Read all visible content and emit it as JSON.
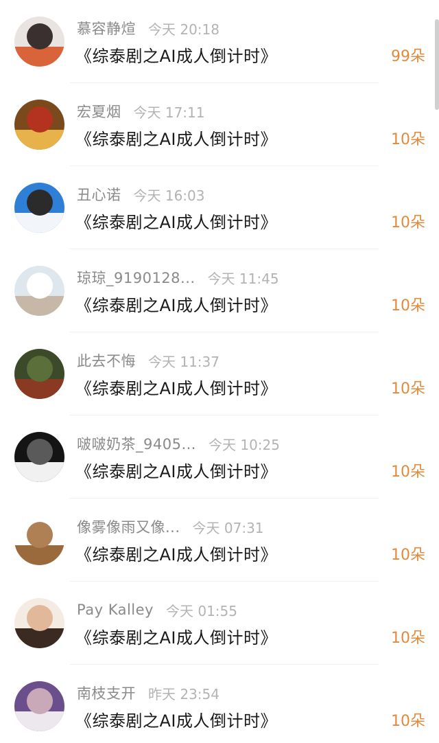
{
  "items": [
    {
      "name": "慕容静煊",
      "time": "今天 20:18",
      "title": "《综泰剧之AI成人倒计时》",
      "count": "99朵",
      "avatar_icon": "woman-in-red-hanfu-avatar",
      "avatar_colors": [
        "#e9e4e2",
        "#d9643a",
        "#3b3030"
      ]
    },
    {
      "name": "宏夏烟",
      "time": "今天 17:11",
      "title": "《综泰剧之AI成人倒计时》",
      "count": "10朵",
      "avatar_icon": "golden-warrior-avatar",
      "avatar_colors": [
        "#7a4a1c",
        "#e8b24a",
        "#b3331f"
      ]
    },
    {
      "name": "丑心诺",
      "time": "今天 16:03",
      "title": "《综泰剧之AI成人倒计时》",
      "count": "10朵",
      "avatar_icon": "girl-blue-sky-avatar",
      "avatar_colors": [
        "#2f7fd6",
        "#f2f6fa",
        "#2b2b2b"
      ]
    },
    {
      "name": "琼琼_9190128...",
      "time": "今天 11:45",
      "title": "《综泰剧之AI成人倒计时》",
      "count": "10朵",
      "avatar_icon": "beach-scene-avatar",
      "avatar_colors": [
        "#dfe7ee",
        "#c7b7a7",
        "#ffffff"
      ]
    },
    {
      "name": "此去不悔",
      "time": "今天 11:37",
      "title": "《综泰剧之AI成人倒计时》",
      "count": "10朵",
      "avatar_icon": "forest-avatar",
      "avatar_colors": [
        "#3c4a2a",
        "#8a3a22",
        "#5a6f3a"
      ]
    },
    {
      "name": "啵啵奶茶_9405...",
      "time": "今天 10:25",
      "title": "《综泰剧之AI成人倒计时》",
      "count": "10朵",
      "avatar_icon": "cat-avatar",
      "avatar_colors": [
        "#141414",
        "#f1f1f1",
        "#5a5a5a"
      ]
    },
    {
      "name": "像雾像雨又像...",
      "time": "今天 07:31",
      "title": "《综泰剧之AI成人倒计时》",
      "count": "10朵",
      "avatar_icon": "calligraphy-logo-avatar",
      "avatar_colors": [
        "#ffffff",
        "#9b6a3c",
        "#b08055"
      ]
    },
    {
      "name": "Pay Kalley",
      "time": "今天 01:55",
      "title": "《综泰剧之AI成人倒计时》",
      "count": "10朵",
      "avatar_icon": "woman-portrait-avatar",
      "avatar_colors": [
        "#f4ebe2",
        "#3a2a22",
        "#e1b99a"
      ]
    },
    {
      "name": "南枝支开",
      "time": "昨天 23:54",
      "title": "《综泰剧之AI成人倒计时》",
      "count": "10朵",
      "avatar_icon": "man-portrait-avatar",
      "avatar_colors": [
        "#6a4f8c",
        "#ece8ee",
        "#c9a8b8"
      ]
    }
  ],
  "colors": {
    "name": "#8a8a8a",
    "time": "#b3b3b3",
    "title": "#1a1a1a",
    "count": "#e08a3c"
  }
}
